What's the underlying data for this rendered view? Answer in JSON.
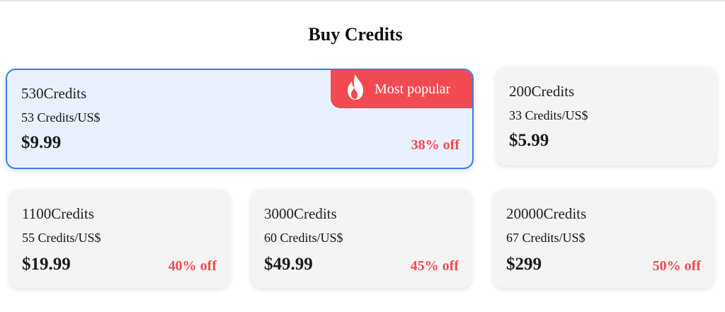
{
  "page": {
    "title": "Buy Credits"
  },
  "badge": {
    "label": "Most popular",
    "icon": "flame-icon",
    "color": "#f24a51"
  },
  "colors": {
    "accent_border": "#3d7de6",
    "popular_background": "#e9f1ff",
    "discount_text": "#f04a4f",
    "card_background": "#f4f4f4"
  },
  "plans": [
    {
      "credits": "530Credits",
      "rate": "53 Credits/US$",
      "price": "$9.99",
      "discount": "38% off",
      "popular": true
    },
    {
      "credits": "200Credits",
      "rate": "33 Credits/US$",
      "price": "$5.99",
      "discount": "",
      "popular": false
    },
    {
      "credits": "1100Credits",
      "rate": "55 Credits/US$",
      "price": "$19.99",
      "discount": "40% off",
      "popular": false
    },
    {
      "credits": "3000Credits",
      "rate": "60 Credits/US$",
      "price": "$49.99",
      "discount": "45% off",
      "popular": false
    },
    {
      "credits": "20000Credits",
      "rate": "67 Credits/US$",
      "price": "$299",
      "discount": "50% off",
      "popular": false
    }
  ]
}
